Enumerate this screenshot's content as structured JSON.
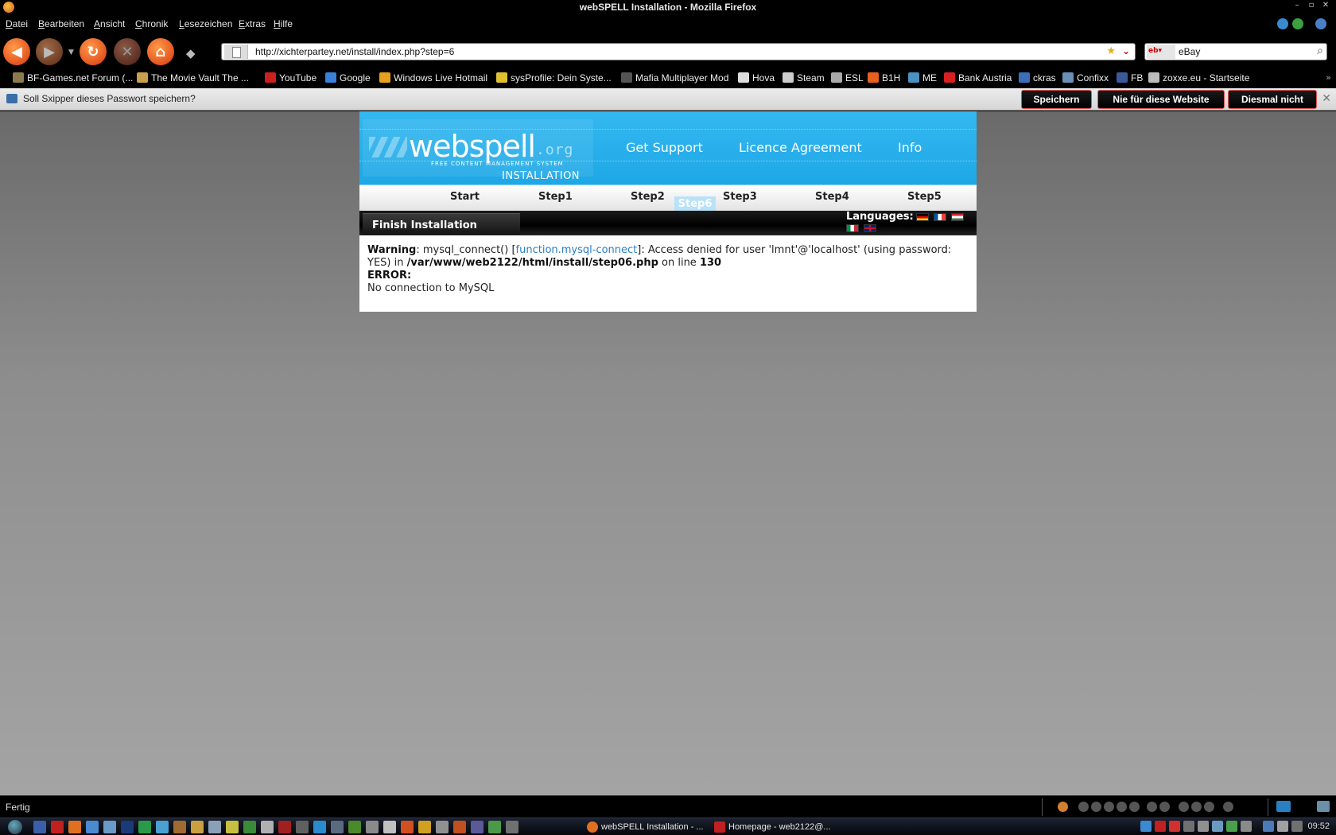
{
  "window": {
    "title": "webSPELL Installation - Mozilla Firefox"
  },
  "menu": {
    "items": [
      "Datei",
      "Bearbeiten",
      "Ansicht",
      "Chronik",
      "Lesezeichen",
      "Extras",
      "Hilfe"
    ]
  },
  "navigation": {
    "url": "http://xichterpartey.net/install/index.php?step=6",
    "search_engine": "eBay",
    "search_value": "eBay"
  },
  "bookmarks": [
    {
      "label": "BF-Games.net Forum (...",
      "color": "#8b7a50"
    },
    {
      "label": "The Movie Vault The ...",
      "color": "#c8a050"
    },
    {
      "label": "YouTube",
      "color": "#cc2020"
    },
    {
      "label": "Google",
      "color": "#3a7fd8"
    },
    {
      "label": "Windows Live Hotmail",
      "color": "#e8a020"
    },
    {
      "label": "sysProfile: Dein Syste...",
      "color": "#e0c030"
    },
    {
      "label": "Mafia Multiplayer Mod",
      "color": "#555555"
    },
    {
      "label": "Hova",
      "color": "#dddddd"
    },
    {
      "label": "Steam",
      "color": "#cccccc"
    },
    {
      "label": "ESL",
      "color": "#aaaaaa"
    },
    {
      "label": "B1H",
      "color": "#e86020"
    },
    {
      "label": "ME",
      "color": "#4a90c0"
    },
    {
      "label": "Bank Austria",
      "color": "#d82020"
    },
    {
      "label": "ckras",
      "color": "#3a6fb8"
    },
    {
      "label": "Confixx",
      "color": "#6a8fb8"
    },
    {
      "label": "FB",
      "color": "#3b5998"
    },
    {
      "label": "zoxxe.eu - Startseite",
      "color": "#bbbbbb"
    }
  ],
  "notification": {
    "text": "Soll Sxipper dieses Passwort speichern?",
    "buttons": [
      "Speichern",
      "Nie für diese Website",
      "Diesmal nicht"
    ]
  },
  "site": {
    "logo": "webspell",
    "logo_suffix": ".org",
    "tagline": "FREE CONTENT MANAGEMENT SYSTEM",
    "subtitle": "INSTALLATION",
    "nav": [
      "Get Support",
      "Licence Agreement",
      "Info"
    ],
    "steps": [
      "Start",
      "Step1",
      "Step2",
      "Step3",
      "Step4",
      "Step5"
    ],
    "active_step": "Step6",
    "section_title": "Finish Installation",
    "languages_label": "Languages:",
    "flags": [
      "flag-de-icon",
      "flag-fr-icon",
      "flag-hu-icon",
      "flag-it-icon",
      "flag-uk-icon"
    ]
  },
  "message": {
    "warning_label": "Warning",
    "warning_text_1": ": mysql_connect() [",
    "warning_link": "function.mysql-connect",
    "warning_text_2": "]: Access denied for user 'lmnt'@'localhost' (using password: YES) in ",
    "file_path": "/var/www/web2122/html/install/step06.php",
    "on_line_text": " on line ",
    "line_number": "130",
    "error_label": "ERROR:",
    "error_text": "No connection to MySQL"
  },
  "status": {
    "text": "Fertig"
  },
  "taskbar": {
    "tasks": [
      {
        "label": "webSPELL Installation - ...",
        "color": "#e07020"
      },
      {
        "label": "Homepage - web2122@...",
        "color": "#c02020"
      }
    ],
    "clock": "09:52"
  }
}
